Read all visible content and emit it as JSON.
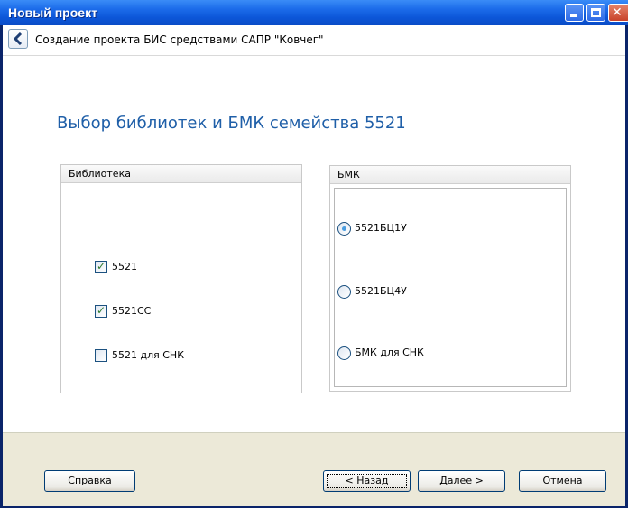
{
  "window": {
    "title": "Новый проект"
  },
  "header": {
    "text": "Создание проекта БИС средствами САПР \"Ковчег\""
  },
  "page_title": "Выбор библиотек и БМК семейства 5521",
  "library_group": {
    "title": "Библиотека",
    "items": [
      {
        "label": "5521",
        "checked": true
      },
      {
        "label": "5521СС",
        "checked": true
      },
      {
        "label": "5521 для СНК",
        "checked": false
      }
    ]
  },
  "bmk_group": {
    "title": "БМК",
    "items": [
      {
        "label": "5521БЦ1У",
        "selected": true
      },
      {
        "label": "5521БЦ4У",
        "selected": false
      },
      {
        "label": "БМК для СНК",
        "selected": false
      }
    ]
  },
  "buttons": {
    "help_prefix": "",
    "help_access": "С",
    "help_rest": "правка",
    "back_prefix": "< ",
    "back_access": "Н",
    "back_rest": "азад",
    "next_access": "Д",
    "next_rest": "алее >",
    "cancel_access": "О",
    "cancel_rest": "тмена"
  },
  "colors": {
    "accent_title": "#1f5fa8",
    "titlebar": "#0c56d8",
    "footer": "#ece9d8"
  },
  "icons": {
    "back": "arrow-left-icon",
    "minimize": "minimize-icon",
    "maximize": "maximize-icon",
    "close": "close-icon"
  }
}
